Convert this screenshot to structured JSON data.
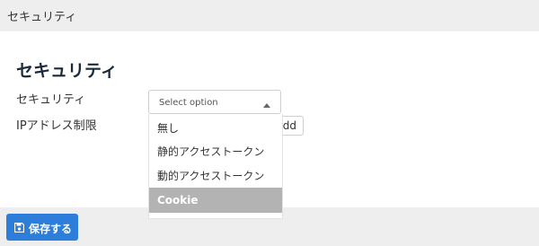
{
  "topbar": {
    "title": "セキュリティ"
  },
  "page": {
    "title": "セキュリティ"
  },
  "form": {
    "security_label": "セキュリティ",
    "ip_restriction_label": "IPアドレス制限",
    "select_placeholder": "Select option",
    "add_button_label": "dd"
  },
  "dropdown": {
    "options": [
      "無し",
      "静的アクセストークン",
      "動的アクセストークン",
      "Cookie"
    ],
    "highlighted": "Cookie"
  },
  "footer": {
    "save_label": "保存する",
    "save_icon": "floppy-disk-icon"
  },
  "colors": {
    "primary": "#2d7ddb",
    "highlight": "#b3b3b3",
    "bar_background": "#eeeeee"
  }
}
